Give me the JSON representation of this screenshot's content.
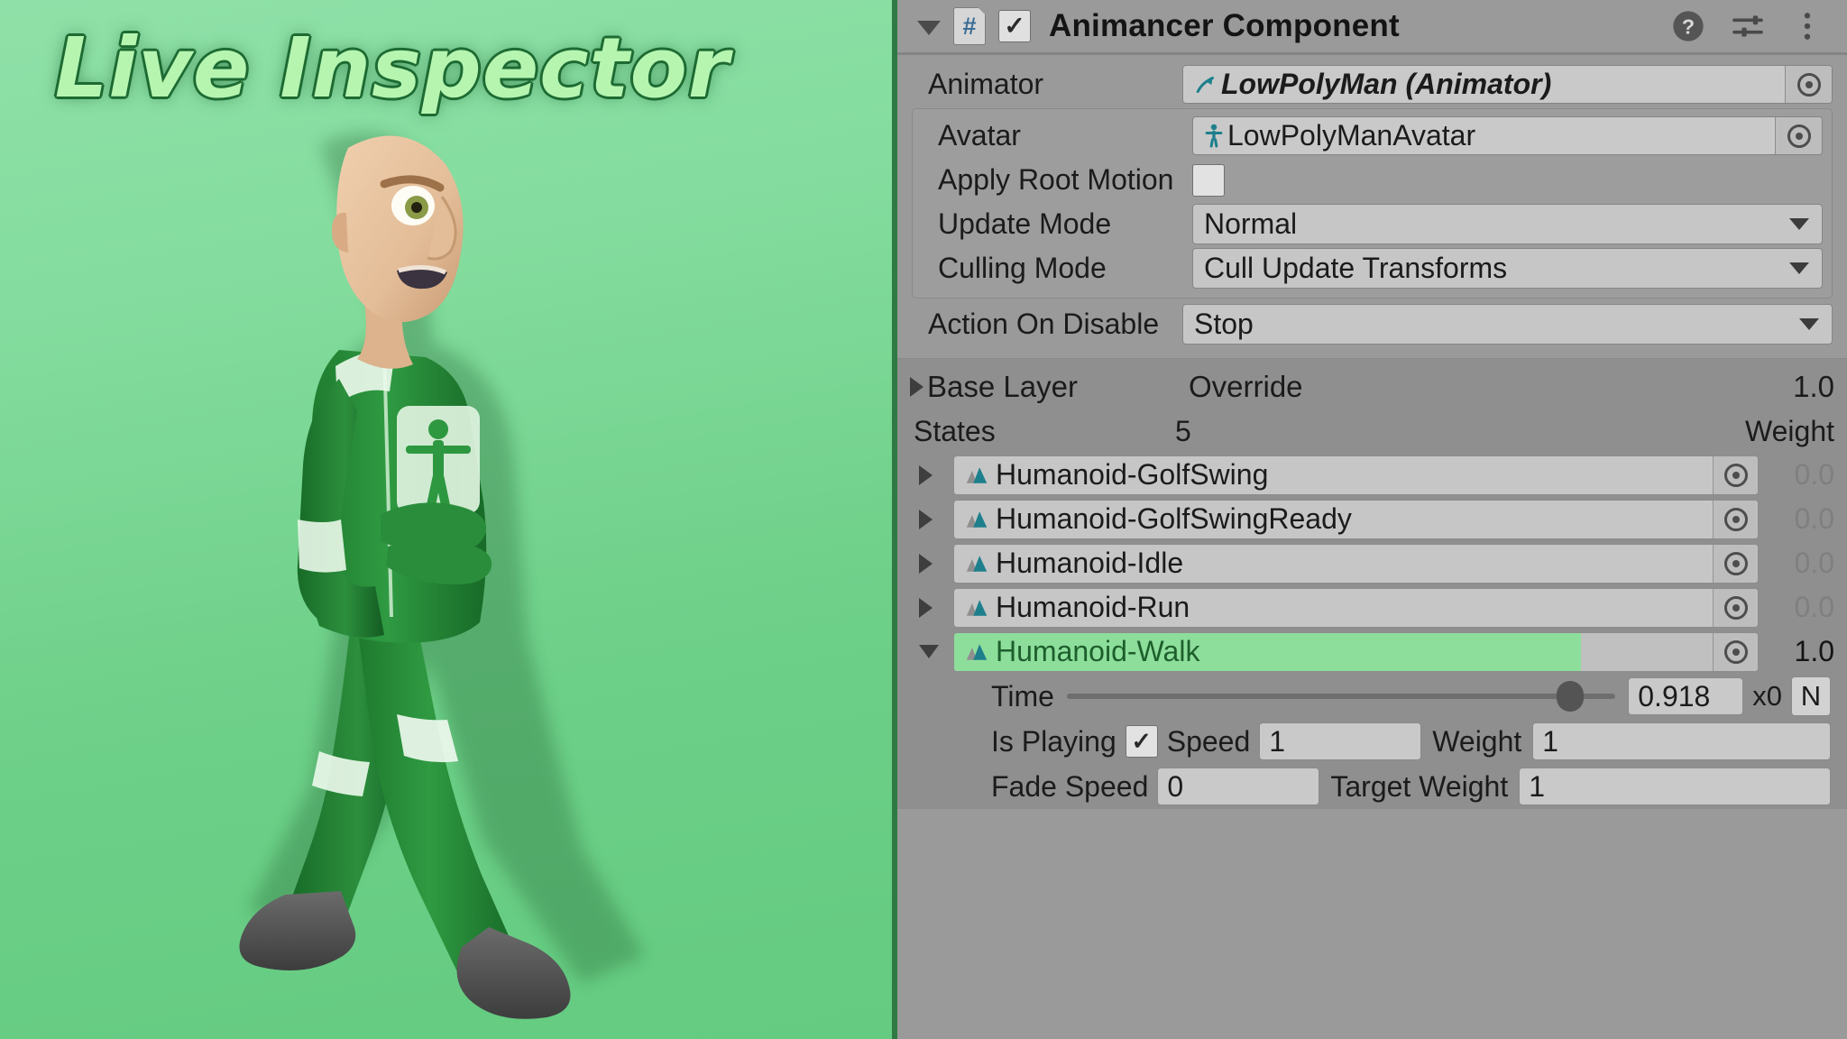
{
  "promo": {
    "title": "Live Inspector",
    "character_alt": "low-poly-man-walking"
  },
  "inspector": {
    "component": {
      "title": "Animancer Component",
      "foldout_icon": "chevron-down-icon",
      "script_icon_glyph": "#",
      "enabled": true,
      "enabled_glyph": "✓",
      "help_icon": "help-icon",
      "preset_icon": "preset-sliders-icon",
      "menu_icon": "more-vertical-icon"
    },
    "fields": {
      "animator": {
        "label": "Animator",
        "value": "LowPolyMan (Animator)",
        "icon": "animator-icon",
        "picker_icon": "object-picker-icon"
      },
      "avatar": {
        "label": "Avatar",
        "value": "LowPolyManAvatar",
        "icon": "avatar-icon",
        "picker_icon": "object-picker-icon"
      },
      "apply_root_motion": {
        "label": "Apply Root Motion",
        "checked": false,
        "check_glyph": ""
      },
      "update_mode": {
        "label": "Update Mode",
        "value": "Normal",
        "arrow_icon": "chevron-down-icon"
      },
      "culling_mode": {
        "label": "Culling Mode",
        "value": "Cull Update Transforms",
        "arrow_icon": "chevron-down-icon"
      },
      "action_on_disable": {
        "label": "Action On Disable",
        "value": "Stop",
        "arrow_icon": "chevron-down-icon"
      }
    },
    "layer": {
      "name": "Base Layer",
      "expand_icon": "triangle-right-icon",
      "blend_mode": "Override",
      "weight": "1.0",
      "states_label": "States",
      "states_count": "5",
      "weight_header": "Weight"
    },
    "states": [
      {
        "name": "Humanoid-GolfSwing",
        "weight": "0.0",
        "weight_ratio": 0,
        "expanded": false,
        "icon": "animation-clip-icon",
        "picker_icon": "object-picker-icon"
      },
      {
        "name": "Humanoid-GolfSwingReady",
        "weight": "0.0",
        "weight_ratio": 0,
        "expanded": false,
        "icon": "animation-clip-icon",
        "picker_icon": "object-picker-icon"
      },
      {
        "name": "Humanoid-Idle",
        "weight": "0.0",
        "weight_ratio": 0,
        "expanded": false,
        "icon": "animation-clip-icon",
        "picker_icon": "object-picker-icon"
      },
      {
        "name": "Humanoid-Run",
        "weight": "0.0",
        "weight_ratio": 0,
        "expanded": false,
        "icon": "animation-clip-icon",
        "picker_icon": "object-picker-icon"
      },
      {
        "name": "Humanoid-Walk",
        "weight": "1.0",
        "weight_ratio": 1,
        "expanded": true,
        "icon": "animation-clip-icon",
        "picker_icon": "object-picker-icon"
      }
    ],
    "state_details": {
      "time": {
        "label": "Time",
        "value": "0.918",
        "slider_ratio": 0.918,
        "multiplier_label": "x0",
        "normalize_button": "N"
      },
      "is_playing": {
        "label": "Is Playing",
        "checked": true,
        "check_glyph": "✓"
      },
      "speed": {
        "label": "Speed",
        "value": "1"
      },
      "weight": {
        "label": "Weight",
        "value": "1"
      },
      "fade_speed": {
        "label": "Fade Speed",
        "value": "0"
      },
      "target_weight": {
        "label": "Target Weight",
        "value": "1"
      }
    }
  },
  "colors": {
    "panel_bg": "#9a9a9a",
    "field_bg": "#c6c6c6",
    "active_green": "#8ede9b",
    "active_text_green": "#1d5f2c",
    "clip_icon_teal": "#1d7f8c",
    "promo_green": "#73d28d"
  }
}
